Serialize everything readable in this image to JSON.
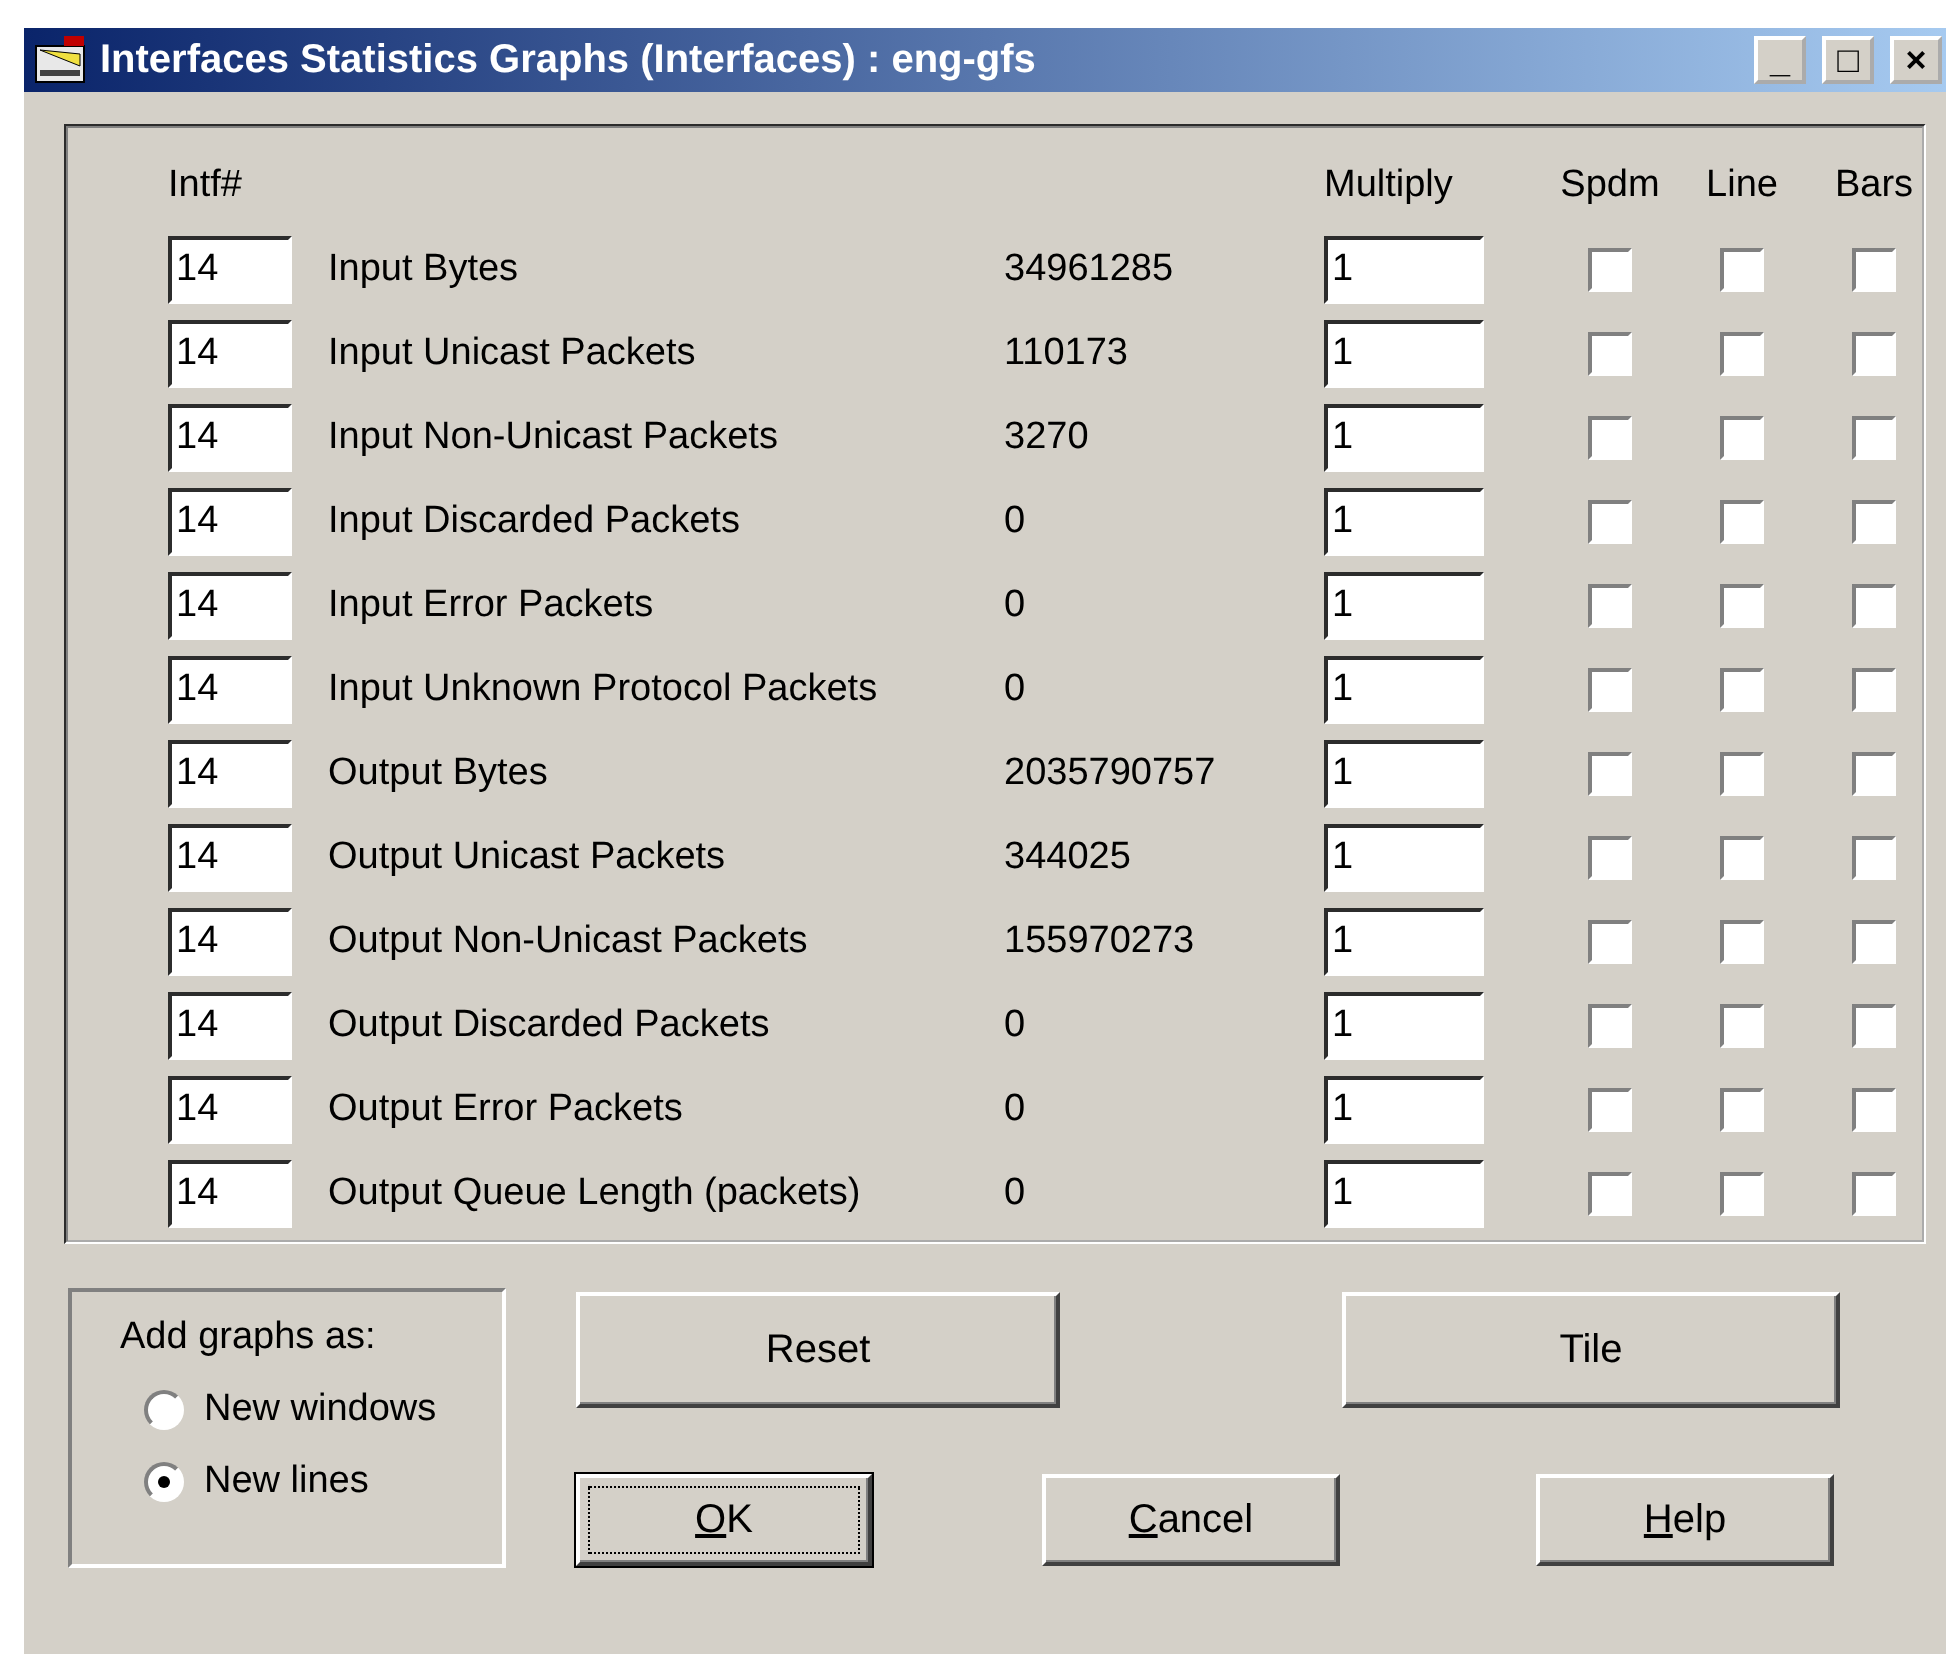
{
  "window": {
    "title": "Interfaces Statistics Graphs (Interfaces) : eng-gfs",
    "controls": [
      "_",
      "□",
      "×"
    ]
  },
  "columns": {
    "intf": "Intf#",
    "multiply": "Multiply",
    "spdm": "Spdm",
    "line": "Line",
    "bars": "Bars"
  },
  "rows": [
    {
      "intf": "14",
      "name": "Input Bytes",
      "value": "34961285",
      "multiply": "1",
      "spdm": false,
      "line": false,
      "bars": false
    },
    {
      "intf": "14",
      "name": "Input Unicast Packets",
      "value": "110173",
      "multiply": "1",
      "spdm": false,
      "line": false,
      "bars": false
    },
    {
      "intf": "14",
      "name": "Input Non-Unicast Packets",
      "value": "3270",
      "multiply": "1",
      "spdm": false,
      "line": false,
      "bars": false
    },
    {
      "intf": "14",
      "name": "Input Discarded Packets",
      "value": "0",
      "multiply": "1",
      "spdm": false,
      "line": false,
      "bars": false
    },
    {
      "intf": "14",
      "name": "Input Error Packets",
      "value": "0",
      "multiply": "1",
      "spdm": false,
      "line": false,
      "bars": false
    },
    {
      "intf": "14",
      "name": "Input Unknown Protocol Packets",
      "value": "0",
      "multiply": "1",
      "spdm": false,
      "line": false,
      "bars": false
    },
    {
      "intf": "14",
      "name": "Output Bytes",
      "value": "2035790757",
      "multiply": "1",
      "spdm": false,
      "line": false,
      "bars": false
    },
    {
      "intf": "14",
      "name": "Output Unicast Packets",
      "value": "344025",
      "multiply": "1",
      "spdm": false,
      "line": false,
      "bars": false
    },
    {
      "intf": "14",
      "name": "Output Non-Unicast Packets",
      "value": "155970273",
      "multiply": "1",
      "spdm": false,
      "line": false,
      "bars": false
    },
    {
      "intf": "14",
      "name": "Output Discarded Packets",
      "value": "0",
      "multiply": "1",
      "spdm": false,
      "line": false,
      "bars": false
    },
    {
      "intf": "14",
      "name": "Output Error Packets",
      "value": "0",
      "multiply": "1",
      "spdm": false,
      "line": false,
      "bars": false
    },
    {
      "intf": "14",
      "name": "Output Queue Length (packets)",
      "value": "0",
      "multiply": "1",
      "spdm": false,
      "line": false,
      "bars": false
    }
  ],
  "add_graphs": {
    "label": "Add graphs as:",
    "options": [
      {
        "label": "New windows",
        "selected": false
      },
      {
        "label": "New lines",
        "selected": true
      }
    ]
  },
  "buttons": [
    {
      "label": "Reset",
      "kind": "wide",
      "focused": false,
      "mnemonic_first": false
    },
    {
      "label": "Tile",
      "kind": "wide",
      "focused": false,
      "mnemonic_first": false
    },
    {
      "label": "OK",
      "kind": "small",
      "focused": true,
      "mnemonic_first": true
    },
    {
      "label": "Cancel",
      "kind": "small",
      "focused": false,
      "mnemonic_first": true
    },
    {
      "label": "Help",
      "kind": "small",
      "focused": false,
      "mnemonic_first": true
    }
  ]
}
